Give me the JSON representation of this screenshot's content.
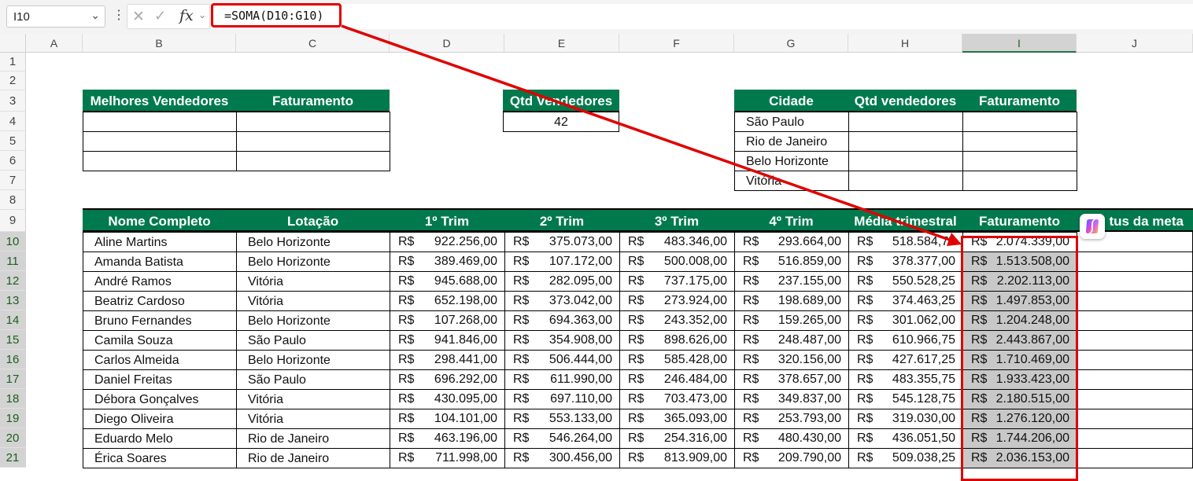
{
  "formula_bar": {
    "name_box": "I10",
    "formula": "=SOMA(D10:G10)",
    "icons": [
      "chevron-down-icon",
      "more-vertical-icon",
      "cancel-icon",
      "check-icon",
      "fx-icon"
    ]
  },
  "columns": [
    "A",
    "B",
    "C",
    "D",
    "E",
    "F",
    "G",
    "H",
    "I",
    "J"
  ],
  "rows": [
    "1",
    "2",
    "3",
    "4",
    "5",
    "6",
    "7",
    "8",
    "9",
    "10",
    "11",
    "12",
    "13",
    "14",
    "15",
    "16",
    "17",
    "18",
    "19",
    "20",
    "21"
  ],
  "top_left_table": {
    "headers": [
      "Melhores Vendedores",
      "Faturamento"
    ]
  },
  "qtd_table": {
    "header": "Qtd Vendedores",
    "value": "42"
  },
  "city_table": {
    "headers": [
      "Cidade",
      "Qtd vendedores",
      "Faturamento"
    ],
    "cities": [
      "São Paulo",
      "Rio de Janeiro",
      "Belo Horizonte",
      "Vitória"
    ]
  },
  "main_table": {
    "headers": [
      "Nome Completo",
      "Lotação",
      "1º Trim",
      "2º Trim",
      "3º Trim",
      "4º Trim",
      "Média trimestral",
      "Faturamento",
      "tus da meta"
    ],
    "currency": "R$",
    "rows": [
      {
        "nome": "Aline Martins",
        "lotacao": "Belo Horizonte",
        "t1": "922.256,00",
        "t2": "375.073,00",
        "t3": "483.346,00",
        "t4": "293.664,00",
        "media": "518.584,75",
        "fat": "2.074.339,00"
      },
      {
        "nome": "Amanda Batista",
        "lotacao": "Belo Horizonte",
        "t1": "389.469,00",
        "t2": "107.172,00",
        "t3": "500.008,00",
        "t4": "516.859,00",
        "media": "378.377,00",
        "fat": "1.513.508,00"
      },
      {
        "nome": "André Ramos",
        "lotacao": "Vitória",
        "t1": "945.688,00",
        "t2": "282.095,00",
        "t3": "737.175,00",
        "t4": "237.155,00",
        "media": "550.528,25",
        "fat": "2.202.113,00"
      },
      {
        "nome": "Beatriz Cardoso",
        "lotacao": "Vitória",
        "t1": "652.198,00",
        "t2": "373.042,00",
        "t3": "273.924,00",
        "t4": "198.689,00",
        "media": "374.463,25",
        "fat": "1.497.853,00"
      },
      {
        "nome": "Bruno Fernandes",
        "lotacao": "Belo Horizonte",
        "t1": "107.268,00",
        "t2": "694.363,00",
        "t3": "243.352,00",
        "t4": "159.265,00",
        "media": "301.062,00",
        "fat": "1.204.248,00"
      },
      {
        "nome": "Camila Souza",
        "lotacao": "São Paulo",
        "t1": "941.846,00",
        "t2": "354.908,00",
        "t3": "898.626,00",
        "t4": "248.487,00",
        "media": "610.966,75",
        "fat": "2.443.867,00"
      },
      {
        "nome": "Carlos Almeida",
        "lotacao": "Belo Horizonte",
        "t1": "298.441,00",
        "t2": "506.444,00",
        "t3": "585.428,00",
        "t4": "320.156,00",
        "media": "427.617,25",
        "fat": "1.710.469,00"
      },
      {
        "nome": "Daniel Freitas",
        "lotacao": "São Paulo",
        "t1": "696.292,00",
        "t2": "611.990,00",
        "t3": "246.484,00",
        "t4": "378.657,00",
        "media": "483.355,75",
        "fat": "1.933.423,00"
      },
      {
        "nome": "Débora Gonçalves",
        "lotacao": "Vitória",
        "t1": "430.095,00",
        "t2": "697.110,00",
        "t3": "703.473,00",
        "t4": "349.837,00",
        "media": "545.128,75",
        "fat": "2.180.515,00"
      },
      {
        "nome": "Diego Oliveira",
        "lotacao": "Vitória",
        "t1": "104.101,00",
        "t2": "553.133,00",
        "t3": "365.093,00",
        "t4": "253.793,00",
        "media": "319.030,00",
        "fat": "1.276.120,00"
      },
      {
        "nome": "Eduardo Melo",
        "lotacao": "Rio de Janeiro",
        "t1": "463.196,00",
        "t2": "546.264,00",
        "t3": "254.316,00",
        "t4": "480.430,00",
        "media": "436.051,50",
        "fat": "1.744.206,00"
      },
      {
        "nome": "Érica Soares",
        "lotacao": "Rio de Janeiro",
        "t1": "711.998,00",
        "t2": "300.456,00",
        "t3": "813.909,00",
        "t4": "209.790,00",
        "media": "509.038,25",
        "fat": "2.036.153,00"
      }
    ]
  },
  "colors": {
    "header_green": "#007a4d",
    "highlight_red": "#e00000",
    "selection_gray": "#c8c8c8"
  }
}
